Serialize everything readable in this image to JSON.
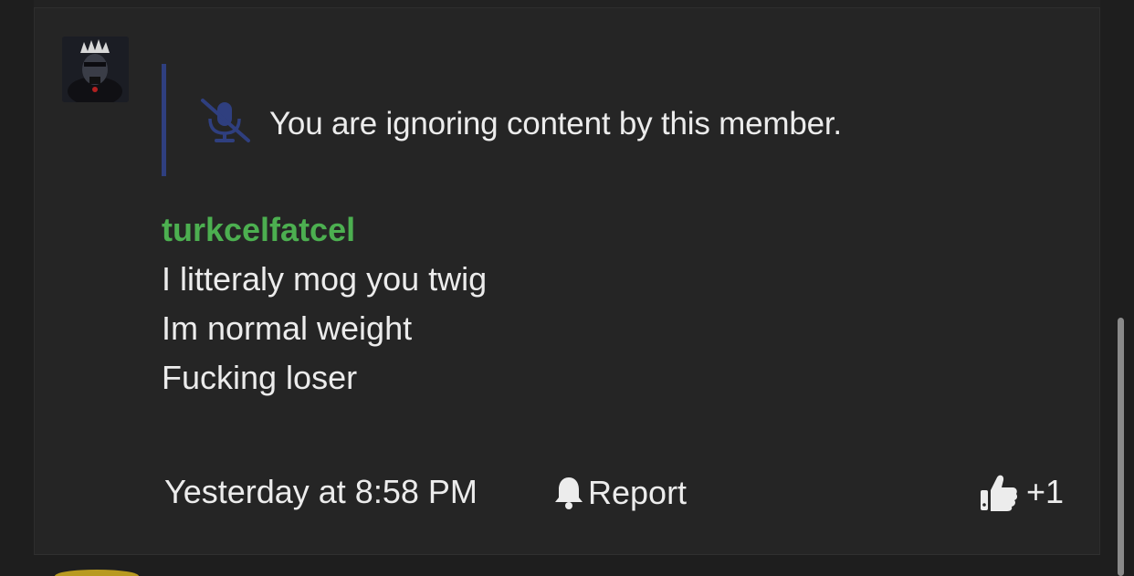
{
  "post": {
    "ignore_notice": "You are ignoring content by this member.",
    "quoted_username": "turkcelfatcel",
    "message_lines": [
      "I litteraly mog you twig",
      "Im normal weight",
      "Fucking loser"
    ],
    "timestamp": "Yesterday at 8:58 PM",
    "report_label": "Report",
    "reaction_count": "+1"
  },
  "icons": {
    "ignore": "muted-microphone-icon",
    "report": "bell-icon",
    "like": "thumbs-up-icon"
  },
  "colors": {
    "background": "#1e1e1e",
    "card": "#252525",
    "quote_bar": "#2f3f7f",
    "ignore_icon": "#2f3f7f",
    "username": "#4caf50",
    "text": "#ececec"
  }
}
